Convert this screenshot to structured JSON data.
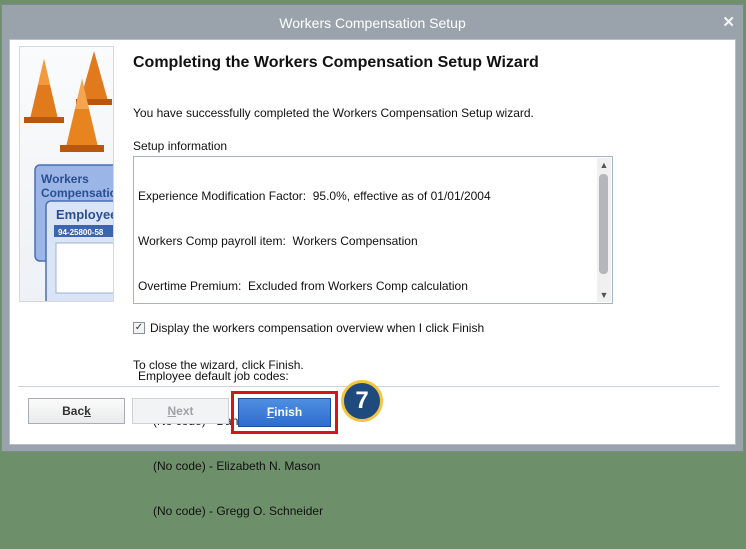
{
  "window": {
    "title": "Workers Compensation Setup",
    "close_glyph": "✕"
  },
  "side_art": {
    "card1_title_line1": "Workers",
    "card1_title_line2": "Compensation",
    "card2_title": "Employee",
    "card2_number": "94-25800-58"
  },
  "heading": "Completing the Workers Compensation Setup Wizard",
  "intro": "You have successfully completed the Workers Compensation Setup wizard.",
  "setup_label": "Setup information",
  "setup_lines": [
    "Experience Modification Factor:  95.0%, effective as of 01/01/2004",
    "Workers Comp payroll item:  Workers Compensation",
    "Overtime Premium:  Excluded from Workers Comp calculation",
    "",
    "Employee default job codes:",
    "(No code) - Dan T. Miller",
    "(No code) - Elizabeth N. Mason",
    "(No code) - Gregg O. Schneider"
  ],
  "checkbox": {
    "checked": true,
    "glyph": "✓",
    "label": "Display the workers compensation overview when I click Finish"
  },
  "close_instruction": "To close the wizard, click Finish.",
  "buttons": {
    "back": {
      "pre": "Bac",
      "ul": "k",
      "post": ""
    },
    "next": {
      "pre": "",
      "ul": "N",
      "post": "ext"
    },
    "finish": {
      "pre": "",
      "ul": "F",
      "post": "inish"
    }
  },
  "step_badge": "7",
  "colors": {
    "highlight_red": "#d8141b",
    "badge_fill": "#1f4a7d",
    "badge_ring": "#f3c541",
    "finish_blue": "#2f6cd0"
  },
  "icons": [
    "traffic-cone-icon",
    "close-icon",
    "scroll-up-icon",
    "scroll-down-icon",
    "checkmark-icon"
  ]
}
